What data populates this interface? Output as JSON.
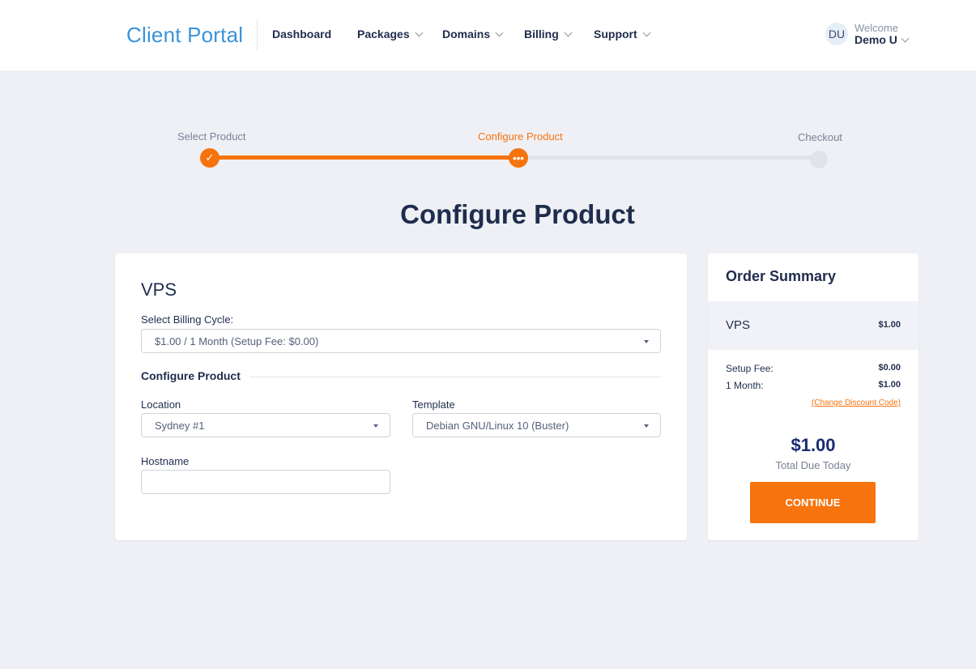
{
  "header": {
    "logo": "Client Portal",
    "nav": [
      {
        "label": "Dashboard"
      },
      {
        "label": "Packages"
      },
      {
        "label": "Domains"
      },
      {
        "label": "Billing"
      },
      {
        "label": "Support"
      }
    ],
    "user": {
      "initials": "DU",
      "welcome": "Welcome",
      "name": "Demo U"
    }
  },
  "stepper": {
    "steps": [
      {
        "label": "Select Product",
        "state": "done",
        "icon": "✓"
      },
      {
        "label": "Configure Product",
        "state": "current",
        "icon": "•••"
      },
      {
        "label": "Checkout",
        "state": "pending",
        "icon": ""
      }
    ],
    "progress_percent": 50
  },
  "page_title": "Configure Product",
  "main": {
    "product_name": "VPS",
    "billing_label": "Select Billing Cycle:",
    "billing_value": "$1.00 / 1 Month (Setup Fee: $0.00)",
    "section_title": "Configure Product",
    "location_label": "Location",
    "location_value": "Sydney #1",
    "template_label": "Template",
    "template_value": "Debian GNU/Linux 10 (Buster)",
    "hostname_label": "Hostname",
    "hostname_value": ""
  },
  "summary": {
    "title": "Order Summary",
    "product_name": "VPS",
    "product_price": "$1.00",
    "lines": [
      {
        "label": "Setup Fee:",
        "value": "$0.00"
      },
      {
        "label": "1 Month:",
        "value": "$1.00"
      }
    ],
    "discount_link": "(Change Discount Code)",
    "total": "$1.00",
    "total_label": "Total Due Today",
    "continue_label": "CONTINUE"
  },
  "colors": {
    "accent": "#f7730e",
    "brand": "#3b93d9",
    "total": "#1a2c73"
  }
}
